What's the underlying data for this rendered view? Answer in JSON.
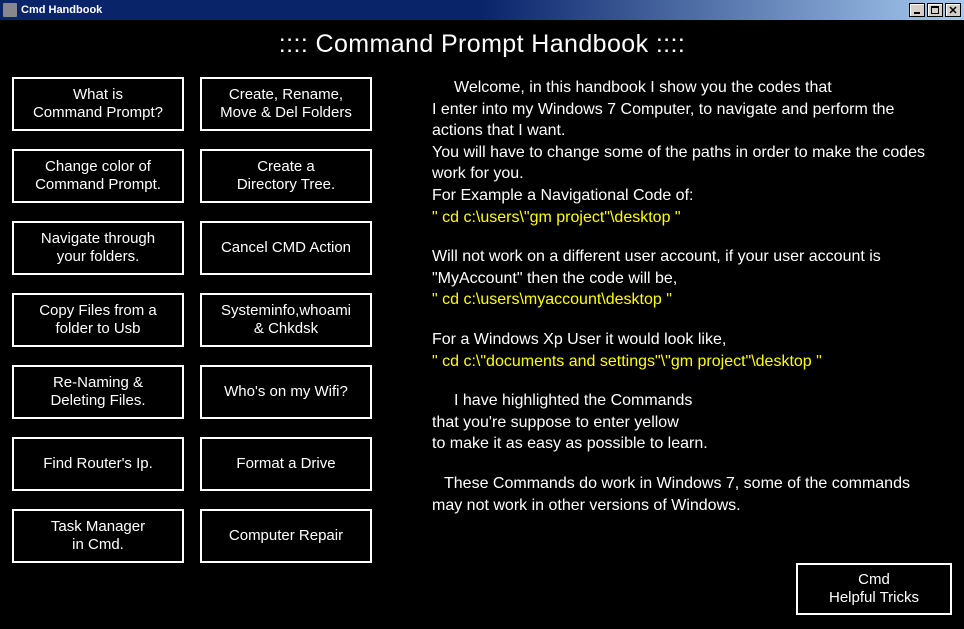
{
  "window": {
    "title": "Cmd Handbook"
  },
  "heading": "::::   Command Prompt Handbook   ::::",
  "buttons": {
    "col1": [
      "What is\nCommand Prompt?",
      "Change color of\nCommand Prompt.",
      "Navigate through\nyour folders.",
      "Copy Files from a\nfolder to Usb",
      "Re-Naming &\nDeleting Files.",
      "Find Router's Ip.",
      "Task Manager\nin Cmd."
    ],
    "col2": [
      "Create, Rename,\nMove & Del Folders",
      "Create a\nDirectory Tree.",
      "Cancel CMD Action",
      "Systeminfo,whoami\n& Chkdsk",
      "Who's on my Wifi?",
      "Format a Drive",
      "Computer Repair"
    ]
  },
  "info": {
    "p1a": "Welcome, in this handbook I show you the codes that",
    "p1b": "I enter into my Windows 7 Computer, to navigate and perform the actions that I want.",
    "p2": "You will have to change some of the paths in order to make the codes work for you.",
    "p3": "For Example a Navigational Code of:",
    "code1": "\" cd c:\\users\\\"gm project\"\\desktop \"",
    "p4": "Will not work on a different user account, if your user account is \"MyAccount\" then the code will be,",
    "code2": "\" cd c:\\users\\myaccount\\desktop \"",
    "p5": "For a Windows Xp User it would look like,",
    "code3": "\" cd c:\\\"documents and settings\"\\\"gm project\"\\desktop \"",
    "p6a": "I have highlighted the Commands",
    "p6b": "that you're suppose to enter yellow",
    "p6c": "to make it as easy as possible to learn.",
    "p7": "These Commands do work in Windows 7, some of the commands may not work in other versions of Windows."
  },
  "helpful": "Cmd\nHelpful Tricks"
}
